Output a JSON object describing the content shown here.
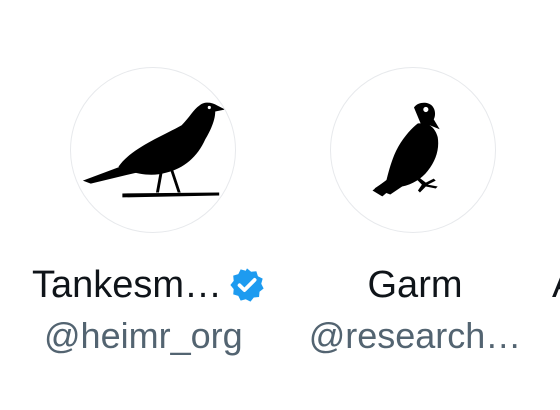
{
  "accounts": [
    {
      "display_name": "Tankesm…",
      "handle": "@heimr_org",
      "verified": true,
      "avatar_icon": "raven-perched-icon"
    },
    {
      "display_name": "Garm",
      "handle": "@research…",
      "verified": false,
      "avatar_icon": "raven-sitting-icon"
    },
    {
      "display_name_partial": "A"
    }
  ],
  "colors": {
    "name_text": "#0f1419",
    "handle_text": "#536471",
    "verified_blue": "#1d9bf0",
    "avatar_border": "#e7e9ec"
  }
}
